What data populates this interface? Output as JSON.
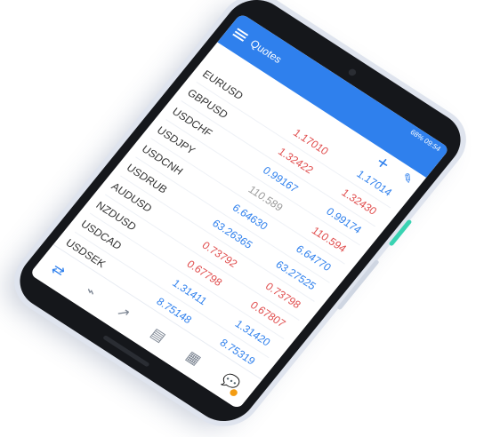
{
  "app": {
    "title": "Quotes",
    "status_text": "68%",
    "time": "09:54"
  },
  "quotes": [
    {
      "symbol": "EURUSD",
      "bid": "1.17010",
      "bid_dir": "down",
      "ask": "1.17014",
      "ask_dir": "up"
    },
    {
      "symbol": "GBPUSD",
      "bid": "1.32422",
      "bid_dir": "down",
      "ask": "1.32430",
      "ask_dir": "down"
    },
    {
      "symbol": "USDCHF",
      "bid": "0.99167",
      "bid_dir": "up",
      "ask": "0.99174",
      "ask_dir": "up"
    },
    {
      "symbol": "USDJPY",
      "bid": "110.589",
      "bid_dir": "neutral",
      "ask": "110.594",
      "ask_dir": "down"
    },
    {
      "symbol": "USDCNH",
      "bid": "6.64630",
      "bid_dir": "up",
      "ask": "6.64770",
      "ask_dir": "up"
    },
    {
      "symbol": "USDRUB",
      "bid": "63.26365",
      "bid_dir": "up",
      "ask": "63.27525",
      "ask_dir": "up"
    },
    {
      "symbol": "AUDUSD",
      "bid": "0.73792",
      "bid_dir": "down",
      "ask": "0.73798",
      "ask_dir": "down"
    },
    {
      "symbol": "NZDUSD",
      "bid": "0.67798",
      "bid_dir": "down",
      "ask": "0.67807",
      "ask_dir": "down"
    },
    {
      "symbol": "USDCAD",
      "bid": "1.31411",
      "bid_dir": "up",
      "ask": "1.31420",
      "ask_dir": "up"
    },
    {
      "symbol": "USDSEK",
      "bid": "8.75148",
      "bid_dir": "up",
      "ask": "8.75319",
      "ask_dir": "up"
    }
  ],
  "nav": {
    "items": [
      {
        "icon": "quotes-icon",
        "active": true
      },
      {
        "icon": "chart-icon",
        "active": false
      },
      {
        "icon": "trade-icon",
        "active": false
      },
      {
        "icon": "history-icon",
        "active": false
      },
      {
        "icon": "news-icon",
        "active": false
      },
      {
        "icon": "chat-icon",
        "active": false
      }
    ]
  },
  "colors": {
    "accent": "#2f80ed",
    "up": "#2f80ed",
    "down": "#e04c4c",
    "neutral": "#9a9a9a",
    "side_key": "#39d3b2"
  }
}
